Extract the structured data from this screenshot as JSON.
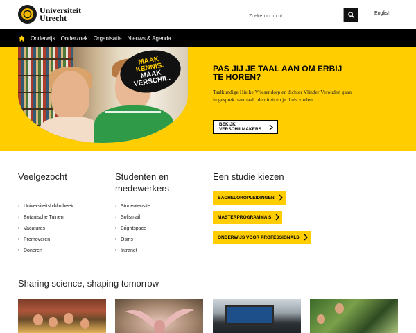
{
  "header": {
    "logo_line1": "Universiteit",
    "logo_line2": "Utrecht",
    "search_placeholder": "Zoeken in uu.nl",
    "language": "English"
  },
  "nav": {
    "items": [
      "Onderwijs",
      "Onderzoek",
      "Organisatie",
      "Nieuws & Agenda"
    ]
  },
  "hero": {
    "sign_lines": [
      "MAAK",
      "KENNIS.",
      "MAAK",
      "VERSCHIL."
    ],
    "title": "PAS JIJ JE TAAL AAN OM ERBIJ TE HOREN?",
    "text": "Taalkundige Hielke Vriesendorp en dichter Vlinder Verouden gaan in gesprek over taal, identiteit en je thuis voelen.",
    "button": "BEKIJK VERSCHILMAKERS"
  },
  "veelgezocht": {
    "title": "Veelgezocht",
    "items": [
      "Universiteitsbibliotheek",
      "Botanische Tuinen",
      "Vacatures",
      "Promoveren",
      "Doneren"
    ]
  },
  "studenten": {
    "title": "Studenten en medewerkers",
    "items": [
      "Studentensite",
      "Solismail",
      "Brightspace",
      "Osiris",
      "Intranet"
    ]
  },
  "studie": {
    "title": "Een studie kiezen",
    "buttons": [
      "BACHELOROPLEIDINGEN",
      "MASTERPROGRAMMA'S",
      "ONDERWIJS VOOR PROFESSIONALS"
    ]
  },
  "sharing": {
    "title": "Sharing science, shaping tomorrow"
  },
  "colors": {
    "brand_yellow": "#ffcd00",
    "nav_black": "#000000"
  },
  "icons": {
    "search": "search-icon",
    "home": "home-icon",
    "chevron": "chevron-right-icon"
  }
}
